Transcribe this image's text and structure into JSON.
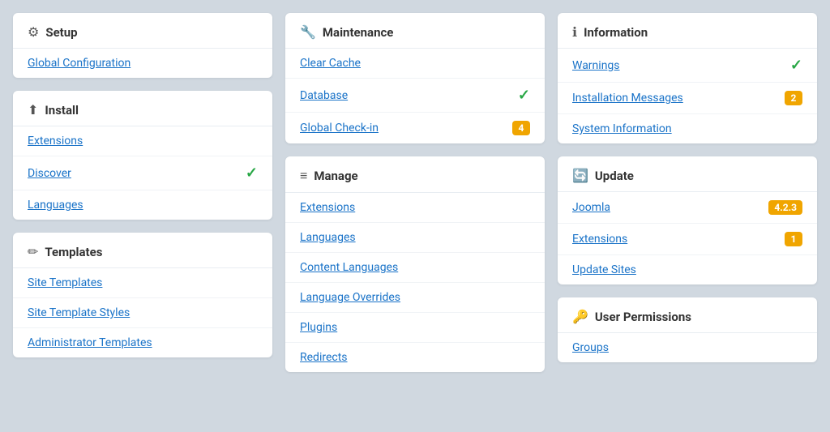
{
  "columns": [
    {
      "cards": [
        {
          "id": "setup",
          "icon": "⚙",
          "title": "Setup",
          "items": [
            {
              "label": "Global Configuration",
              "badge": null,
              "check": false
            }
          ]
        },
        {
          "id": "install",
          "icon": "⬆",
          "title": "Install",
          "items": [
            {
              "label": "Extensions",
              "badge": null,
              "check": false
            },
            {
              "label": "Discover",
              "badge": null,
              "check": true
            },
            {
              "label": "Languages",
              "badge": null,
              "check": false
            }
          ]
        },
        {
          "id": "templates",
          "icon": "✏",
          "title": "Templates",
          "items": [
            {
              "label": "Site Templates",
              "badge": null,
              "check": false
            },
            {
              "label": "Site Template Styles",
              "badge": null,
              "check": false
            },
            {
              "label": "Administrator Templates",
              "badge": null,
              "check": false
            }
          ]
        }
      ]
    },
    {
      "cards": [
        {
          "id": "maintenance",
          "icon": "🔧",
          "title": "Maintenance",
          "items": [
            {
              "label": "Clear Cache",
              "badge": null,
              "check": false
            },
            {
              "label": "Database",
              "badge": null,
              "check": true
            },
            {
              "label": "Global Check-in",
              "badge": "4",
              "check": false
            }
          ]
        },
        {
          "id": "manage",
          "icon": "≡",
          "title": "Manage",
          "items": [
            {
              "label": "Extensions",
              "badge": null,
              "check": false
            },
            {
              "label": "Languages",
              "badge": null,
              "check": false
            },
            {
              "label": "Content Languages",
              "badge": null,
              "check": false
            },
            {
              "label": "Language Overrides",
              "badge": null,
              "check": false
            },
            {
              "label": "Plugins",
              "badge": null,
              "check": false
            },
            {
              "label": "Redirects",
              "badge": null,
              "check": false
            }
          ]
        }
      ]
    },
    {
      "cards": [
        {
          "id": "information",
          "icon": "ℹ",
          "title": "Information",
          "items": [
            {
              "label": "Warnings",
              "badge": null,
              "check": true
            },
            {
              "label": "Installation Messages",
              "badge": "2",
              "check": false
            },
            {
              "label": "System Information",
              "badge": null,
              "check": false
            }
          ]
        },
        {
          "id": "update",
          "icon": "🔄",
          "title": "Update",
          "items": [
            {
              "label": "Joomla",
              "badge": "4.2.3",
              "check": false
            },
            {
              "label": "Extensions",
              "badge": "1",
              "check": false
            },
            {
              "label": "Update Sites",
              "badge": null,
              "check": false
            }
          ]
        },
        {
          "id": "user-permissions",
          "icon": "🔑",
          "title": "User Permissions",
          "items": [
            {
              "label": "Groups",
              "badge": null,
              "check": false
            }
          ]
        }
      ]
    }
  ]
}
